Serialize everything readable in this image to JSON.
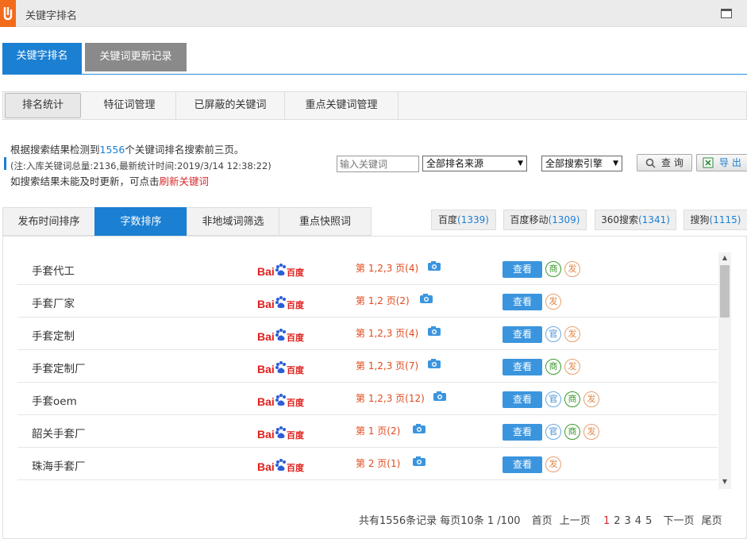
{
  "window": {
    "title": "关键字排名"
  },
  "main_tabs": [
    {
      "label": "关键字排名"
    },
    {
      "label": "关键词更新记录"
    }
  ],
  "sub_tabs": [
    {
      "label": "排名统计"
    },
    {
      "label": "特征词管理"
    },
    {
      "label": "已屏蔽的关键词"
    },
    {
      "label": "重点关键词管理"
    }
  ],
  "info": {
    "line1_prefix": "根据搜索结果检测到",
    "line1_count": "1556",
    "line1_suffix": "个关键词排名搜索前三页。",
    "line2": "(注:入库关键词总量:2136,最新统计时间:2019/3/14 12:38:22)",
    "line3_prefix": "如搜索结果未能及时更新，可点击",
    "line3_link": "刷新关键词"
  },
  "search": {
    "placeholder": "输入关键词"
  },
  "filters": {
    "source_select": "全部排名来源",
    "engine_select": "全部搜索引擎",
    "query_button": "查 询",
    "export_button": "导 出"
  },
  "filter_tabs": [
    {
      "label": "发布时间排序"
    },
    {
      "label": "字数排序"
    },
    {
      "label": "非地域词筛选"
    },
    {
      "label": "重点快照词"
    }
  ],
  "engines": [
    {
      "name": "百度",
      "count": "(1339)"
    },
    {
      "name": "百度移动",
      "count": "(1309)"
    },
    {
      "name": "360搜索",
      "count": "(1341)"
    },
    {
      "name": "搜狗",
      "count": "(1115)"
    }
  ],
  "engine_logo": {
    "text_bai": "Bai",
    "text_du": "百度"
  },
  "rows": [
    {
      "keyword": "手套代工",
      "rank": "第 1,2,3 页(4)",
      "view": "查看",
      "badges": [
        "商",
        "发"
      ]
    },
    {
      "keyword": "手套厂家",
      "rank": "第 1,2 页(2)",
      "view": "查看",
      "badges": [
        "发"
      ]
    },
    {
      "keyword": "手套定制",
      "rank": "第 1,2,3 页(4)",
      "view": "查看",
      "badges": [
        "官",
        "发"
      ]
    },
    {
      "keyword": "手套定制厂",
      "rank": "第 1,2,3 页(7)",
      "view": "查看",
      "badges": [
        "商",
        "发"
      ]
    },
    {
      "keyword": "手套oem",
      "rank": "第 1,2,3 页(12)",
      "view": "查看",
      "badges": [
        "官",
        "商",
        "发"
      ]
    },
    {
      "keyword": "韶关手套厂",
      "rank": "第 1 页(2)",
      "view": "查看",
      "badges": [
        "官",
        "商",
        "发"
      ]
    },
    {
      "keyword": "珠海手套厂",
      "rank": "第 2 页(1)",
      "view": "查看",
      "badges": [
        "发"
      ]
    }
  ],
  "pager": {
    "summary": "共有1556条记录 每页10条 1 /100",
    "first": "首页",
    "prev": "上一页",
    "pages": [
      "1",
      "2",
      "3",
      "4",
      "5"
    ],
    "current": "1",
    "next": "下一页",
    "last": "尾页"
  },
  "colors": {
    "accent": "#1b7fd2",
    "rank_red": "#e04a1c",
    "brand_orange": "#f26b1d"
  }
}
